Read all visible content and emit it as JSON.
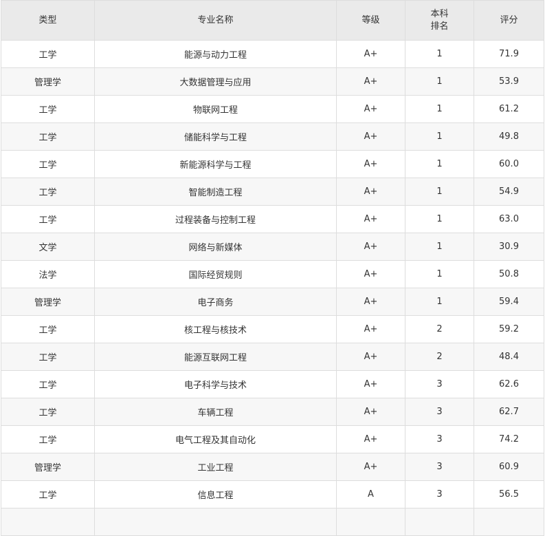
{
  "table": {
    "headers": {
      "type": "类型",
      "major": "专业名称",
      "grade": "等级",
      "rank_line1": "本科",
      "rank_line2": "排名",
      "score": "评分"
    },
    "rows": [
      {
        "type": "工学",
        "major": "能源与动力工程",
        "grade": "A+",
        "rank": "1",
        "score": "71.9"
      },
      {
        "type": "管理学",
        "major": "大数据管理与应用",
        "grade": "A+",
        "rank": "1",
        "score": "53.9"
      },
      {
        "type": "工学",
        "major": "物联网工程",
        "grade": "A+",
        "rank": "1",
        "score": "61.2"
      },
      {
        "type": "工学",
        "major": "储能科学与工程",
        "grade": "A+",
        "rank": "1",
        "score": "49.8"
      },
      {
        "type": "工学",
        "major": "新能源科学与工程",
        "grade": "A+",
        "rank": "1",
        "score": "60.0"
      },
      {
        "type": "工学",
        "major": "智能制造工程",
        "grade": "A+",
        "rank": "1",
        "score": "54.9"
      },
      {
        "type": "工学",
        "major": "过程装备与控制工程",
        "grade": "A+",
        "rank": "1",
        "score": "63.0"
      },
      {
        "type": "文学",
        "major": "网络与新媒体",
        "grade": "A+",
        "rank": "1",
        "score": "30.9"
      },
      {
        "type": "法学",
        "major": "国际经贸规则",
        "grade": "A+",
        "rank": "1",
        "score": "50.8"
      },
      {
        "type": "管理学",
        "major": "电子商务",
        "grade": "A+",
        "rank": "1",
        "score": "59.4"
      },
      {
        "type": "工学",
        "major": "核工程与核技术",
        "grade": "A+",
        "rank": "2",
        "score": "59.2"
      },
      {
        "type": "工学",
        "major": "能源互联网工程",
        "grade": "A+",
        "rank": "2",
        "score": "48.4"
      },
      {
        "type": "工学",
        "major": "电子科学与技术",
        "grade": "A+",
        "rank": "3",
        "score": "62.6"
      },
      {
        "type": "工学",
        "major": "车辆工程",
        "grade": "A+",
        "rank": "3",
        "score": "62.7"
      },
      {
        "type": "工学",
        "major": "电气工程及其自动化",
        "grade": "A+",
        "rank": "3",
        "score": "74.2"
      },
      {
        "type": "管理学",
        "major": "工业工程",
        "grade": "A+",
        "rank": "3",
        "score": "60.9"
      },
      {
        "type": "工学",
        "major": "信息工程",
        "grade": "A",
        "rank": "3",
        "score": "56.5"
      }
    ]
  }
}
